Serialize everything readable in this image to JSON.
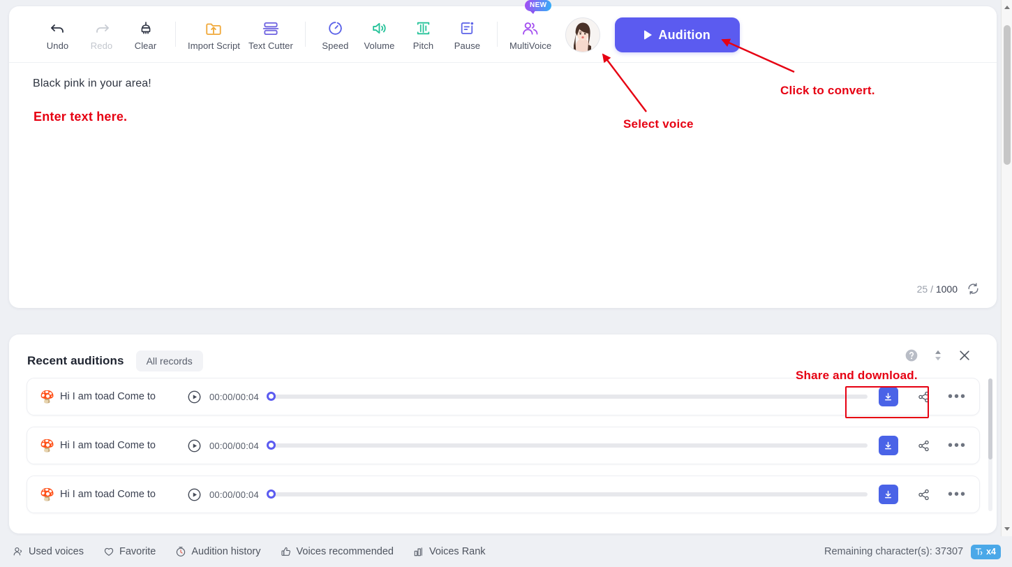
{
  "toolbar": {
    "items": [
      {
        "label": "Undo",
        "icon": "undo-icon",
        "disabled": false
      },
      {
        "label": "Redo",
        "icon": "redo-icon",
        "disabled": true
      },
      {
        "label": "Clear",
        "icon": "broom-icon",
        "disabled": false
      },
      {
        "label": "Import Script",
        "icon": "import-folder-icon",
        "disabled": false
      },
      {
        "label": "Text Cutter",
        "icon": "text-cutter-icon",
        "disabled": false
      },
      {
        "label": "Speed",
        "icon": "speed-icon",
        "disabled": false
      },
      {
        "label": "Volume",
        "icon": "volume-icon",
        "disabled": false
      },
      {
        "label": "Pitch",
        "icon": "pitch-icon",
        "disabled": false
      },
      {
        "label": "Pause",
        "icon": "pause-insert-icon",
        "disabled": false
      },
      {
        "label": "MultiVoice",
        "icon": "multivoice-icon",
        "disabled": false
      }
    ],
    "multivoice_badge": "NEW",
    "audition_label": "Audition",
    "audition_color": "#5b5bf0"
  },
  "editor": {
    "text": "Black pink in your area!",
    "char_count": "25",
    "char_separator": "/",
    "char_limit": "1000"
  },
  "recent": {
    "title": "Recent auditions",
    "all_records_label": "All records",
    "rows": [
      {
        "emoji": "🍄",
        "name": "Hi I am toad Come to",
        "time": "00:00/00:04",
        "progress": 0
      },
      {
        "emoji": "🍄",
        "name": "Hi I am toad Come to",
        "time": "00:00/00:04",
        "progress": 0
      },
      {
        "emoji": "🍄",
        "name": "Hi I am toad Come to",
        "time": "00:00/00:04",
        "progress": 0
      }
    ],
    "more_glyph": "•••"
  },
  "bottombar": {
    "links": [
      {
        "label": "Used voices",
        "icon": "used-voices-icon"
      },
      {
        "label": "Favorite",
        "icon": "heart-icon"
      },
      {
        "label": "Audition history",
        "icon": "clock-history-icon"
      },
      {
        "label": "Voices recommended",
        "icon": "thumbs-up-icon"
      },
      {
        "label": "Voices Rank",
        "icon": "bar-chart-icon"
      }
    ],
    "remaining_text": "Remaining character(s): 37307",
    "multiplier_badge": "x4",
    "badge_color": "#4aa8e8"
  },
  "annotations": {
    "color": "#e60012",
    "enter_text": "Enter text here.",
    "select_voice": "Select voice",
    "click_convert": "Click to convert.",
    "share_download": "Share and download."
  }
}
